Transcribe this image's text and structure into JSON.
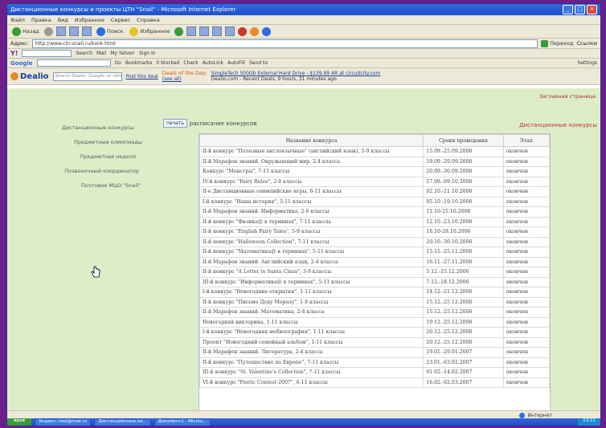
{
  "window": {
    "title": "Дистанционные конкурсы и проекты ЦТН \"Snail\" - Microsoft Internet Explorer"
  },
  "menubar": [
    "Файл",
    "Правка",
    "Вид",
    "Избранное",
    "Сервис",
    "Справка"
  ],
  "toolbar": {
    "back": "Назад",
    "search": "Поиск",
    "favorites": "Избранное"
  },
  "addressbar": {
    "label": "Адрес:",
    "url": "http://www.ctn-snail.ru/konk.html",
    "go": "Переход",
    "links": "Ссылки"
  },
  "yahoobar": {
    "logo": "Y!",
    "search_btn": "Search",
    "items": [
      "Mail",
      "My Yahoo!",
      "Sign In"
    ]
  },
  "googlebar": {
    "logo": "Google",
    "items": [
      "Go",
      "Bookmarks",
      "0 blocked",
      "Check",
      "AutoLink",
      "AutoFill",
      "Send to"
    ],
    "settings": "Settings"
  },
  "dealiobar": {
    "logo": "Dealio",
    "search_placeholder": "Search Dealio, Google, or other",
    "post_deal": "Post this deal",
    "deals_title": "Deals of the Day:",
    "deals_sub": "(see all)",
    "deal_text": "SimpleTech 500Gb External Hard Drive - $139.99 AR at circuitcity.com",
    "deal_time": "Dealio.com - Recent Deals, 9 hours, 31 minutes ago"
  },
  "page": {
    "home_link": "Заглавная страница",
    "print_btn": "печать",
    "print_caption": "расписание конкурсов",
    "right_link": "Дистанционные конкурсы",
    "sidebar": [
      "Дистанционные конкурсы",
      "Предметные олимпиады",
      "Предметная неделя",
      "Позвоночный координатор",
      "Почтовое МЦО \"Snail\""
    ],
    "table": {
      "headers": [
        "Название конкурса",
        "Сроки проведения",
        "Этап"
      ],
      "rows": [
        [
          "II-й конкурс \"Полезные англоязычные\" (английский язык), 5-9 классы",
          "15.09.-25.09.2006",
          "окончен"
        ],
        [
          "II-й Марафон знаний. Окружающий мир, 2-4 класса",
          "19.09.-29.09.2006",
          "окончен"
        ],
        [
          "Конкурс \"Монстры\", 7-11 классы",
          "20.09.-30.09.2006",
          "окончен"
        ],
        [
          "IV-й конкурс \"Fairy Rules\", 2-8 классы",
          "27.09.-09.10.2006",
          "окончен"
        ],
        [
          "II-е Дистанционные олимпийские игры, 6-11 классы",
          "02.10.-21.10.2006",
          "окончен"
        ],
        [
          "I-й конкурс \"Наша история\", 5-11 классы",
          "05.10.-19.10.2006",
          "окончен"
        ],
        [
          "II-й Марафон знаний. Информатика, 2-6 классы",
          "11.10-21.10.2006",
          "окончен"
        ],
        [
          "II-й конкурс \"Физика@ в терминах\", 7-11 классы",
          "12.10.-23.10.2006",
          "окончен"
        ],
        [
          "II-й конкурс \"English Fairy Tales\", 5-9 классы",
          "18.10-28.10.2006",
          "окончен"
        ],
        [
          "II-й конкурс \"Halloween Collection\", 7-11 классы",
          "20.10.-30.10.2006",
          "окончен"
        ],
        [
          "II-й конкурс \"Математика@ в терминах\", 5-11 классы",
          "15.11.-25.11.2006",
          "окончен"
        ],
        [
          "II-й Марафон знаний. Английский язык, 2-4 класса",
          "16.11.-27.11.2006",
          "окончен"
        ],
        [
          "II-й конкурс \"A Letter to Santa Claus\", 3-9 классы",
          "5.12.-15.12.2006",
          "окончен"
        ],
        [
          "III-й конкурс \"Информатика@ в терминах\", 5-11 классы",
          "7.12.-18.12.2006",
          "окончен"
        ],
        [
          "I-й конкурс \"Новогодние открытки\", 1-11 классы",
          "14.12.-21.12.2006",
          "окончен"
        ],
        [
          "II-й конкурс \"Письмо Деду Морозу\", 1-8 классы",
          "15.12.-25.12.2006",
          "окончен"
        ],
        [
          "II-й Марафон знаний. Математика, 2-4 класса",
          "15.12.-25.12.2006",
          "окончен"
        ],
        [
          "Новогодняя викторина, 1-11 классы",
          "19.12.-25.12.2006",
          "окончен"
        ],
        [
          "I-й конкурс \"Новогодняя мобилография\", 1-11 классы",
          "20.12.-25.12.2006",
          "окончен"
        ],
        [
          "Проект \"Новогодний семейный альбом\", 1-11 классы",
          "20.12.-25.12.2006",
          "окончен"
        ],
        [
          "II-й Марафон знаний. Литература, 2-4 класса",
          "19.01.-29.01.2007",
          "окончен"
        ],
        [
          "II-й конкурс \"Путешествие по Европе\", 7-11 классы",
          "23.01.-03.02.2007",
          "окончен"
        ],
        [
          "III-й конкурс \"St. Valentine's Collection\", 7-11 классы",
          "01.02.-14.02.2007",
          "окончен"
        ],
        [
          "VI-й конкурс \"Poetic Contest-2007\", 6-11 классы",
          "16.02.-02.03.2007",
          "окончен"
        ]
      ]
    }
  },
  "statusbar": {
    "zone": "Интернет"
  },
  "taskbar": {
    "start": "пуск",
    "tasks": [
      "Яндекс: lord@mail.ru",
      "Дистанционные ко...",
      "Документ1 - Micros..."
    ],
    "clock": "13:11"
  }
}
